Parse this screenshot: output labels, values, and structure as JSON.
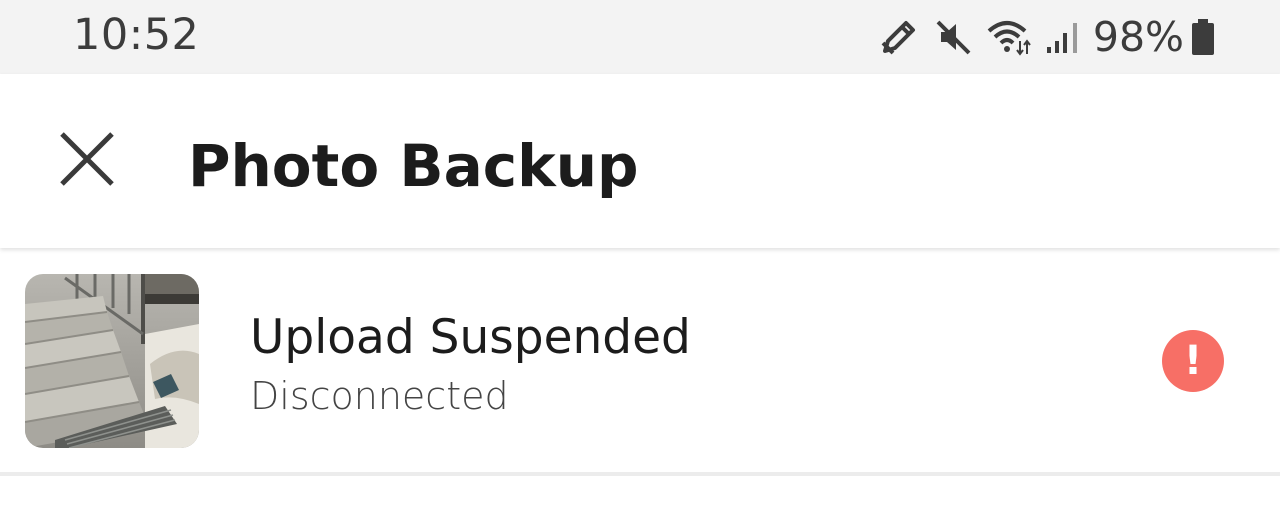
{
  "status_bar": {
    "time": "10:52",
    "battery_percent": "98%",
    "icons": [
      "edit-pen-icon",
      "mute-icon",
      "wifi-icon",
      "signal-icon",
      "battery-icon"
    ]
  },
  "app_bar": {
    "title": "Photo Backup",
    "close_icon": "close-icon"
  },
  "backup_item": {
    "title": "Upload Suspended",
    "status": "Disconnected",
    "badge": "!",
    "badge_icon": "error-exclamation-icon",
    "thumbnail": "photo-thumbnail"
  },
  "colors": {
    "status_bar_bg": "#f3f3f3",
    "error_badge": "#f76f66",
    "title_text": "#1c1c1c",
    "subtitle_text": "#444444"
  }
}
